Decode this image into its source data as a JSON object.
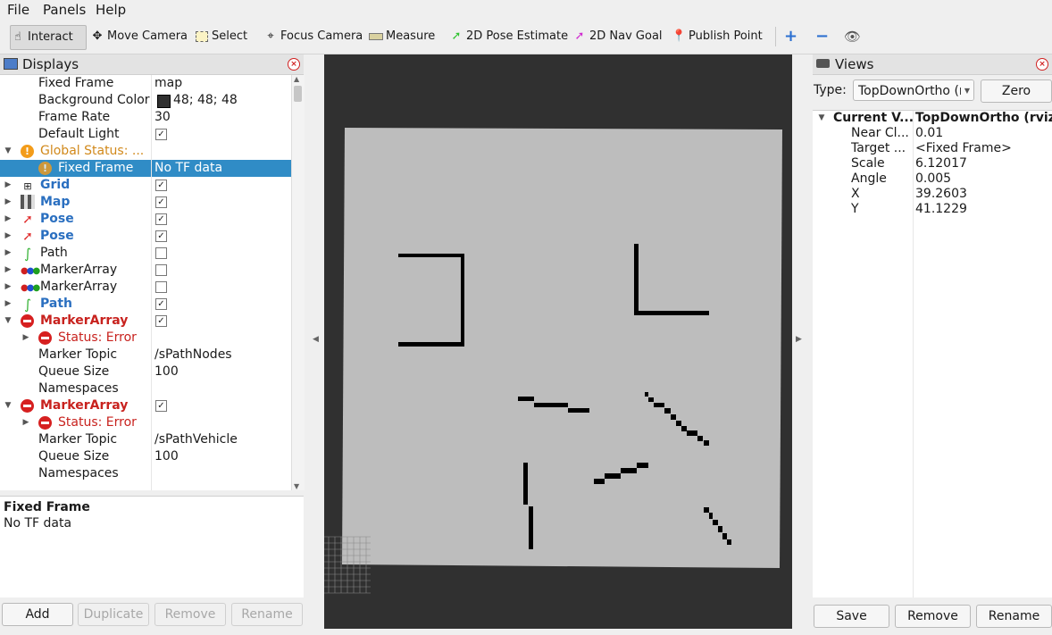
{
  "menu": {
    "file": "File",
    "panels": "Panels",
    "help": "Help"
  },
  "toolbar": {
    "tools": [
      "Interact",
      "Move Camera",
      "Select",
      "Focus Camera",
      "Measure",
      "2D Pose Estimate",
      "2D Nav Goal",
      "Publish Point"
    ],
    "active_tool": "Interact"
  },
  "displays": {
    "title": "Displays",
    "rows": [
      {
        "label": "Fixed Frame",
        "value": "map"
      },
      {
        "label": "Background Color",
        "value": "48; 48; 48"
      },
      {
        "label": "Frame Rate",
        "value": "30"
      },
      {
        "label": "Default Light",
        "value": "checked"
      },
      {
        "label": "Global Status: ...",
        "value": ""
      },
      {
        "label": "Fixed Frame",
        "value": "No TF data"
      },
      {
        "label": "Grid",
        "value": "checked"
      },
      {
        "label": "Map",
        "value": "checked"
      },
      {
        "label": "Pose",
        "value": "checked"
      },
      {
        "label": "Pose",
        "value": "checked"
      },
      {
        "label": "Path",
        "value": "unchecked"
      },
      {
        "label": "MarkerArray",
        "value": "unchecked"
      },
      {
        "label": "MarkerArray",
        "value": "unchecked"
      },
      {
        "label": "Path",
        "value": "checked"
      },
      {
        "label": "MarkerArray",
        "value": "checked"
      },
      {
        "label": "Status: Error",
        "value": ""
      },
      {
        "label": "Marker Topic",
        "value": "/sPathNodes"
      },
      {
        "label": "Queue Size",
        "value": "100"
      },
      {
        "label": "Namespaces",
        "value": ""
      },
      {
        "label": "MarkerArray",
        "value": "checked"
      },
      {
        "label": "Status: Error",
        "value": ""
      },
      {
        "label": "Marker Topic",
        "value": "/sPathVehicle"
      },
      {
        "label": "Queue Size",
        "value": "100"
      },
      {
        "label": "Namespaces",
        "value": ""
      }
    ],
    "description": {
      "title": "Fixed Frame",
      "text": "No TF data"
    },
    "buttons": {
      "add": "Add",
      "duplicate": "Duplicate",
      "remove": "Remove",
      "rename": "Rename"
    }
  },
  "views": {
    "title": "Views",
    "type_label": "Type:",
    "type_value": "TopDownOrtho (rviz)",
    "zero_button": "Zero",
    "current_view": {
      "label": "Current V...",
      "value": "TopDownOrtho (rviz)"
    },
    "properties": [
      {
        "key": "Near Cl...",
        "value": "0.01"
      },
      {
        "key": "Target ...",
        "value": "<Fixed Frame>"
      },
      {
        "key": "Scale",
        "value": "6.12017"
      },
      {
        "key": "Angle",
        "value": "0.005"
      },
      {
        "key": "X",
        "value": "39.2603"
      },
      {
        "key": "Y",
        "value": "41.1229"
      }
    ],
    "buttons": {
      "save": "Save",
      "remove": "Remove",
      "rename": "Rename"
    }
  },
  "colors": {
    "render_bg": "#303030",
    "map_free": "#bdbdbd",
    "obstacle": "#000000",
    "selection": "#308cc6",
    "error": "#d62020",
    "warning": "#f39c1a"
  }
}
